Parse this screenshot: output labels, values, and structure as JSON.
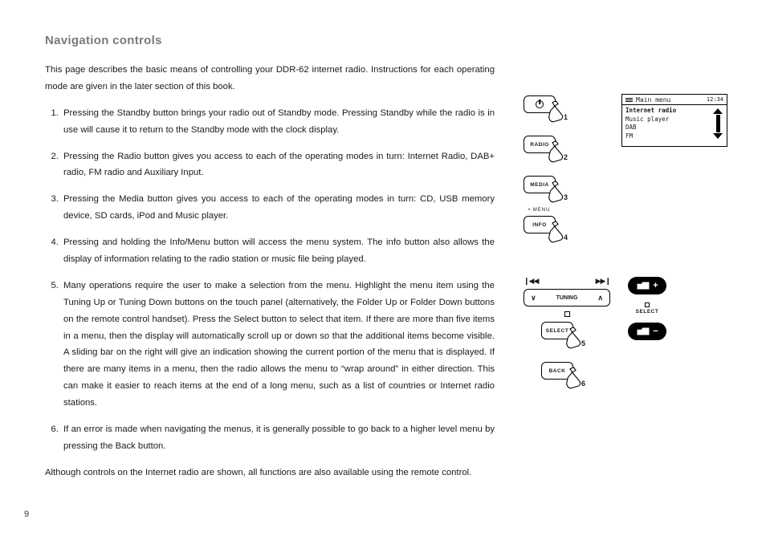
{
  "page_number": "9",
  "title": "Navigation controls",
  "intro": "This page describes the basic means of controlling your DDR-62 internet radio. Instructions for each operating mode are given in the later section of this book.",
  "items": [
    "Pressing the Standby button brings your radio out of Standby mode. Pressing  Standby while the radio is in use will cause it to return to the Standby mode with the clock display.",
    "Pressing the Radio button gives you access to each of the operating modes in turn: Internet Radio, DAB+ radio, FM radio and Auxiliary Input.",
    "Pressing the Media button gives you access to each of the operating modes in turn: CD, USB memory device, SD cards, iPod and Music player.",
    "Pressing and holding the Info/Menu button will access the menu system. The info button also allows the display of information relating to the radio station or music file being played.",
    "Many operations require the user to make a selection from the menu. Highlight the menu item using the Tuning Up or Tuning Down buttons on the touch panel (alternatively, the Folder Up or Folder Down buttons on the remote control handset). Press the Select button to select that item. If there are more than five items in a menu, then the display will automatically scroll up or down so that the additional items become visible. A sliding bar on the right will give an indication showing the current portion of the menu that is displayed. If there are many items in a menu, then the radio allows the menu to “wrap around” in either direction. This can make it easier to reach items at the end of a long menu, such as a list of countries or Internet radio stations.",
    "If an error is made when navigating the menus, it is generally possible to go back to a higher level menu by pressing the Back button."
  ],
  "outro": "Although controls on the Internet radio are shown, all functions are also available using the remote control.",
  "buttons": {
    "b1": {
      "num": "1",
      "label": ""
    },
    "b2": {
      "num": "2",
      "label": "RADIO"
    },
    "b3": {
      "num": "3",
      "label": "MEDIA"
    },
    "b4": {
      "num": "4",
      "label": "INFO",
      "over": "• MENU"
    },
    "b5": {
      "num": "5",
      "label": "SELECT"
    },
    "b6": {
      "num": "6",
      "label": "BACK"
    }
  },
  "tuning": {
    "left": "∨",
    "label": "TUNING",
    "right": "∧",
    "skip_prev": "❙◀◀",
    "skip_next": "▶▶❙"
  },
  "lcd": {
    "title": "Main menu",
    "time": "12:34",
    "items": [
      "Internet radio",
      "Music player",
      "DAB",
      "FM"
    ],
    "selected": 0
  },
  "oval": {
    "plus": "+",
    "minus": "−",
    "select": "SELECT"
  }
}
